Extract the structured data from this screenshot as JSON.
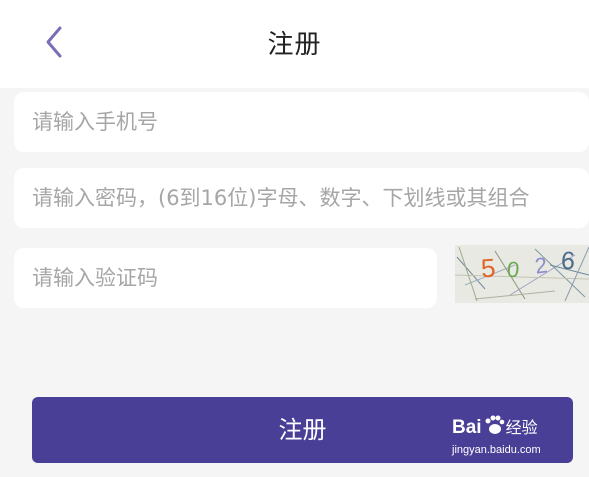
{
  "header": {
    "back_icon": "chevron-left-icon",
    "title": "注册"
  },
  "form": {
    "phone": {
      "placeholder": "请输入手机号",
      "value": ""
    },
    "password": {
      "placeholder": "请输入密码，(6到16位)字母、数字、下划线或其组合",
      "value": ""
    },
    "captcha_input": {
      "placeholder": "请输入验证码",
      "value": ""
    },
    "captcha_image": {
      "text": "5026",
      "digits": [
        "5",
        "0",
        "2",
        "6"
      ],
      "digit_colors": [
        "#e0662a",
        "#6aa84f",
        "#8e8ecf",
        "#4a6b8a"
      ]
    }
  },
  "register_button": {
    "label": "注册",
    "color": "#4a3f96"
  },
  "watermark": {
    "logo_text": "Bai",
    "logo_text_cn": "经验",
    "url": "jingyan.baidu.com"
  },
  "colors": {
    "accent": "#4a3f96",
    "page_background": "#f5f5f5",
    "back_icon": "#7a6fb6"
  }
}
